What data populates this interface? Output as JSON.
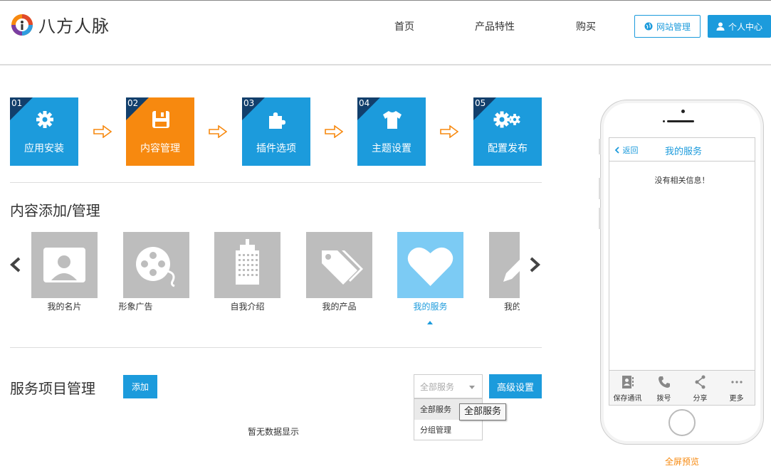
{
  "header": {
    "brand": "八方人脉",
    "nav": [
      "首页",
      "产品特性",
      "购买"
    ],
    "site_manage": "网站管理",
    "user_center": "个人中心"
  },
  "steps": [
    {
      "num": "01",
      "label": "应用安装",
      "icon": "gear-icon"
    },
    {
      "num": "02",
      "label": "内容管理",
      "icon": "floppy-icon",
      "active": true
    },
    {
      "num": "03",
      "label": "插件选项",
      "icon": "puzzle-icon"
    },
    {
      "num": "04",
      "label": "主题设置",
      "icon": "shirt-icon"
    },
    {
      "num": "05",
      "label": "配置发布",
      "icon": "gears-icon"
    }
  ],
  "content_section": {
    "title": "内容添加/管理",
    "tiles": [
      {
        "label": "我的名片",
        "icon": "profile-card-icon"
      },
      {
        "label": "形象广告",
        "icon": "film-reel-icon"
      },
      {
        "label": "自我介绍",
        "icon": "building-icon"
      },
      {
        "label": "我的产品",
        "icon": "tag-icon"
      },
      {
        "label": "我的服务",
        "icon": "heart-icon",
        "active": true
      },
      {
        "label": "我的",
        "icon": "pencil-icon"
      }
    ]
  },
  "service_section": {
    "title": "服务项目管理",
    "add_label": "添加",
    "filter_value": "全部服务",
    "filter_options": [
      "全部服务",
      "分组管理"
    ],
    "tooltip": "全部服务",
    "advanced_label": "高级设置",
    "empty_text": "暂无数据显示"
  },
  "phone": {
    "back_label": "返回",
    "title": "我的服务",
    "message": "没有相关信息！",
    "tabs": [
      {
        "label": "保存通讯",
        "icon": "contact-card-icon"
      },
      {
        "label": "拨号",
        "icon": "phone-icon"
      },
      {
        "label": "分享",
        "icon": "share-icon"
      },
      {
        "label": "更多",
        "icon": "more-icon"
      }
    ],
    "fullscreen_label": "全屏预览"
  },
  "colors": {
    "primary": "#1c9bdc",
    "accent": "#f7890f",
    "tile_gray": "#bdbdbd",
    "tile_active": "#7ccbf4"
  }
}
